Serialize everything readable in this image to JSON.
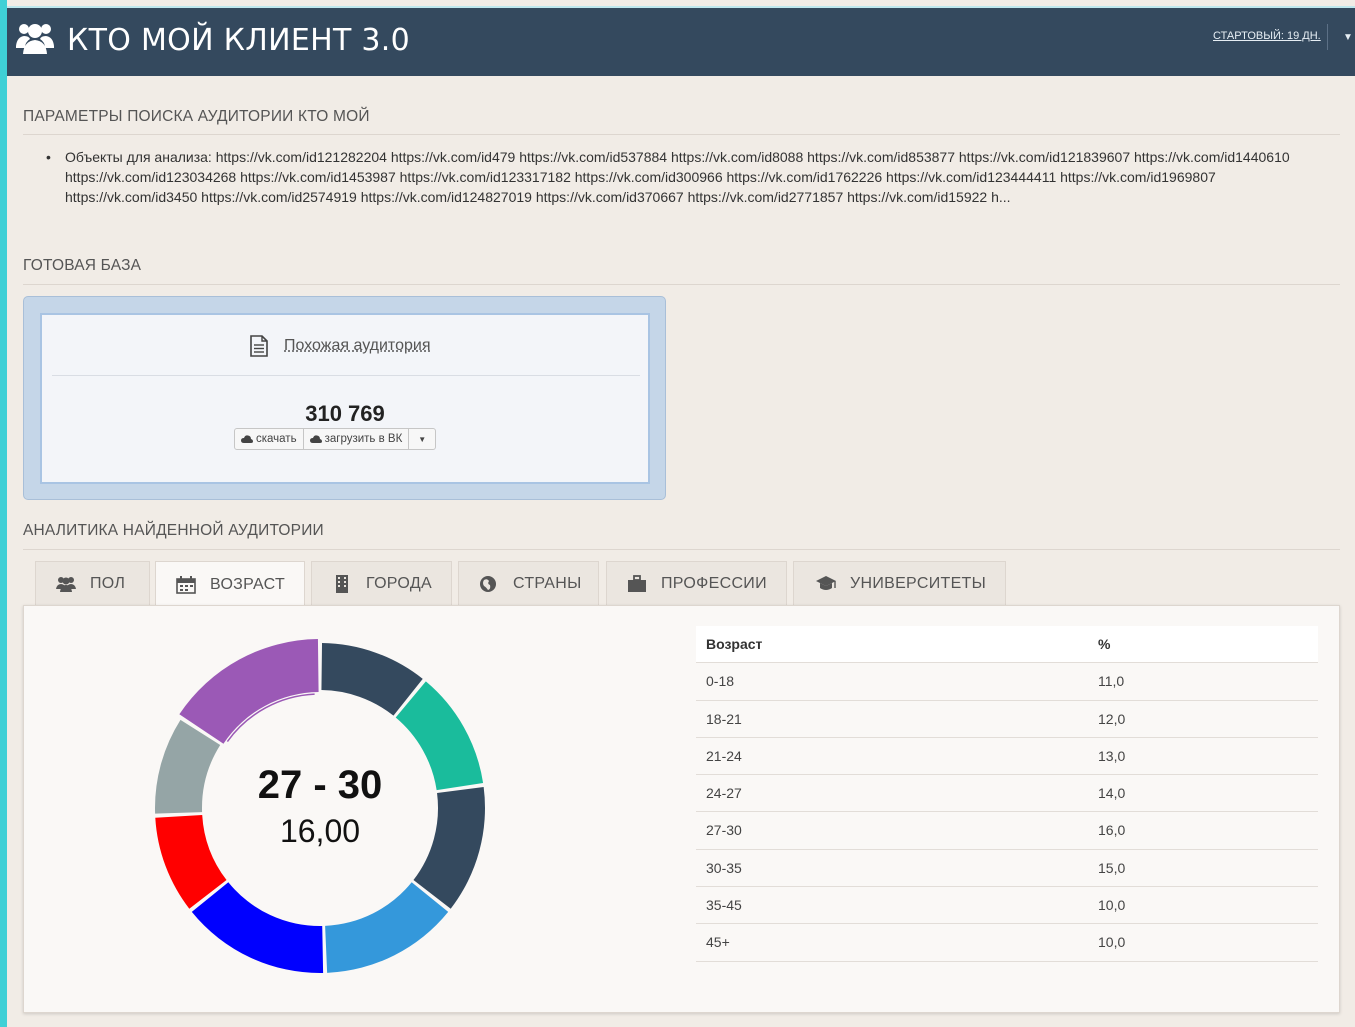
{
  "header": {
    "title": "КТО МОЙ КЛИЕНТ 3.0",
    "plan_label": "СТАРТОВЫЙ: 19 ДН."
  },
  "params_section": {
    "title": "ПАРАМЕТРЫ ПОИСКА АУДИТОРИИ КТО МОЙ",
    "objects_text": "Объекты для анализа: https://vk.com/id121282204 https://vk.com/id479 https://vk.com/id537884 https://vk.com/id8088 https://vk.com/id853877 https://vk.com/id121839607 https://vk.com/id1440610 https://vk.com/id123034268 https://vk.com/id1453987 https://vk.com/id123317182 https://vk.com/id300966 https://vk.com/id1762226 https://vk.com/id123444411 https://vk.com/id1969807 https://vk.com/id3450 https://vk.com/id2574919 https://vk.com/id124827019 https://vk.com/id370667 https://vk.com/id2771857 https://vk.com/id15922 h..."
  },
  "ready_base": {
    "title": "ГОТОВАЯ БАЗА",
    "audience_link": "Похожая аудитория",
    "count": "310 769",
    "download_label": "скачать",
    "upload_label": "загрузить в ВК"
  },
  "analytics": {
    "title": "АНАЛИТИКА НАЙДЕННОЙ АУДИТОРИИ",
    "tabs": [
      {
        "label": "ПОЛ",
        "icon": "users-icon"
      },
      {
        "label": "ВОЗРАСТ",
        "icon": "calendar-icon"
      },
      {
        "label": "ГОРОДА",
        "icon": "building-icon"
      },
      {
        "label": "СТРАНЫ",
        "icon": "globe-icon"
      },
      {
        "label": "ПРОФЕССИИ",
        "icon": "briefcase-icon"
      },
      {
        "label": "УНИВЕРСИТЕТЫ",
        "icon": "graduation-cap-icon"
      }
    ],
    "active_tab": "ВОЗРАСТ",
    "center_range": "27 - 30",
    "center_value": "16,00",
    "table_header": {
      "age": "Возраст",
      "pct": "%"
    },
    "rows": [
      {
        "age": "0-18",
        "pct": "11,0"
      },
      {
        "age": "18-21",
        "pct": "12,0"
      },
      {
        "age": "21-24",
        "pct": "13,0"
      },
      {
        "age": "24-27",
        "pct": "14,0"
      },
      {
        "age": "27-30",
        "pct": "16,0"
      },
      {
        "age": "30-35",
        "pct": "15,0"
      },
      {
        "age": "35-45",
        "pct": "10,0"
      },
      {
        "age": "45+",
        "pct": "10,0"
      }
    ]
  },
  "chart_data": {
    "type": "pie",
    "categories": [
      "0-18",
      "18-21",
      "21-24",
      "24-27",
      "27-30",
      "30-35",
      "35-45",
      "45+"
    ],
    "values": [
      11,
      12,
      13,
      14,
      16,
      15,
      10,
      10
    ],
    "segment_order_clockwise": [
      "0-18",
      "18-21",
      "21-24",
      "24-27",
      "30-35",
      "35-45",
      "45+",
      "27-30"
    ],
    "colors": {
      "0-18": "#34495e",
      "18-21": "#1abc9c",
      "21-24": "#34495e",
      "24-27": "#3498db",
      "30-35": "#0000ff",
      "35-45": "#ff0000",
      "45+": "#95a5a6",
      "27-30": "#9b59b6"
    },
    "highlighted": "27-30"
  }
}
